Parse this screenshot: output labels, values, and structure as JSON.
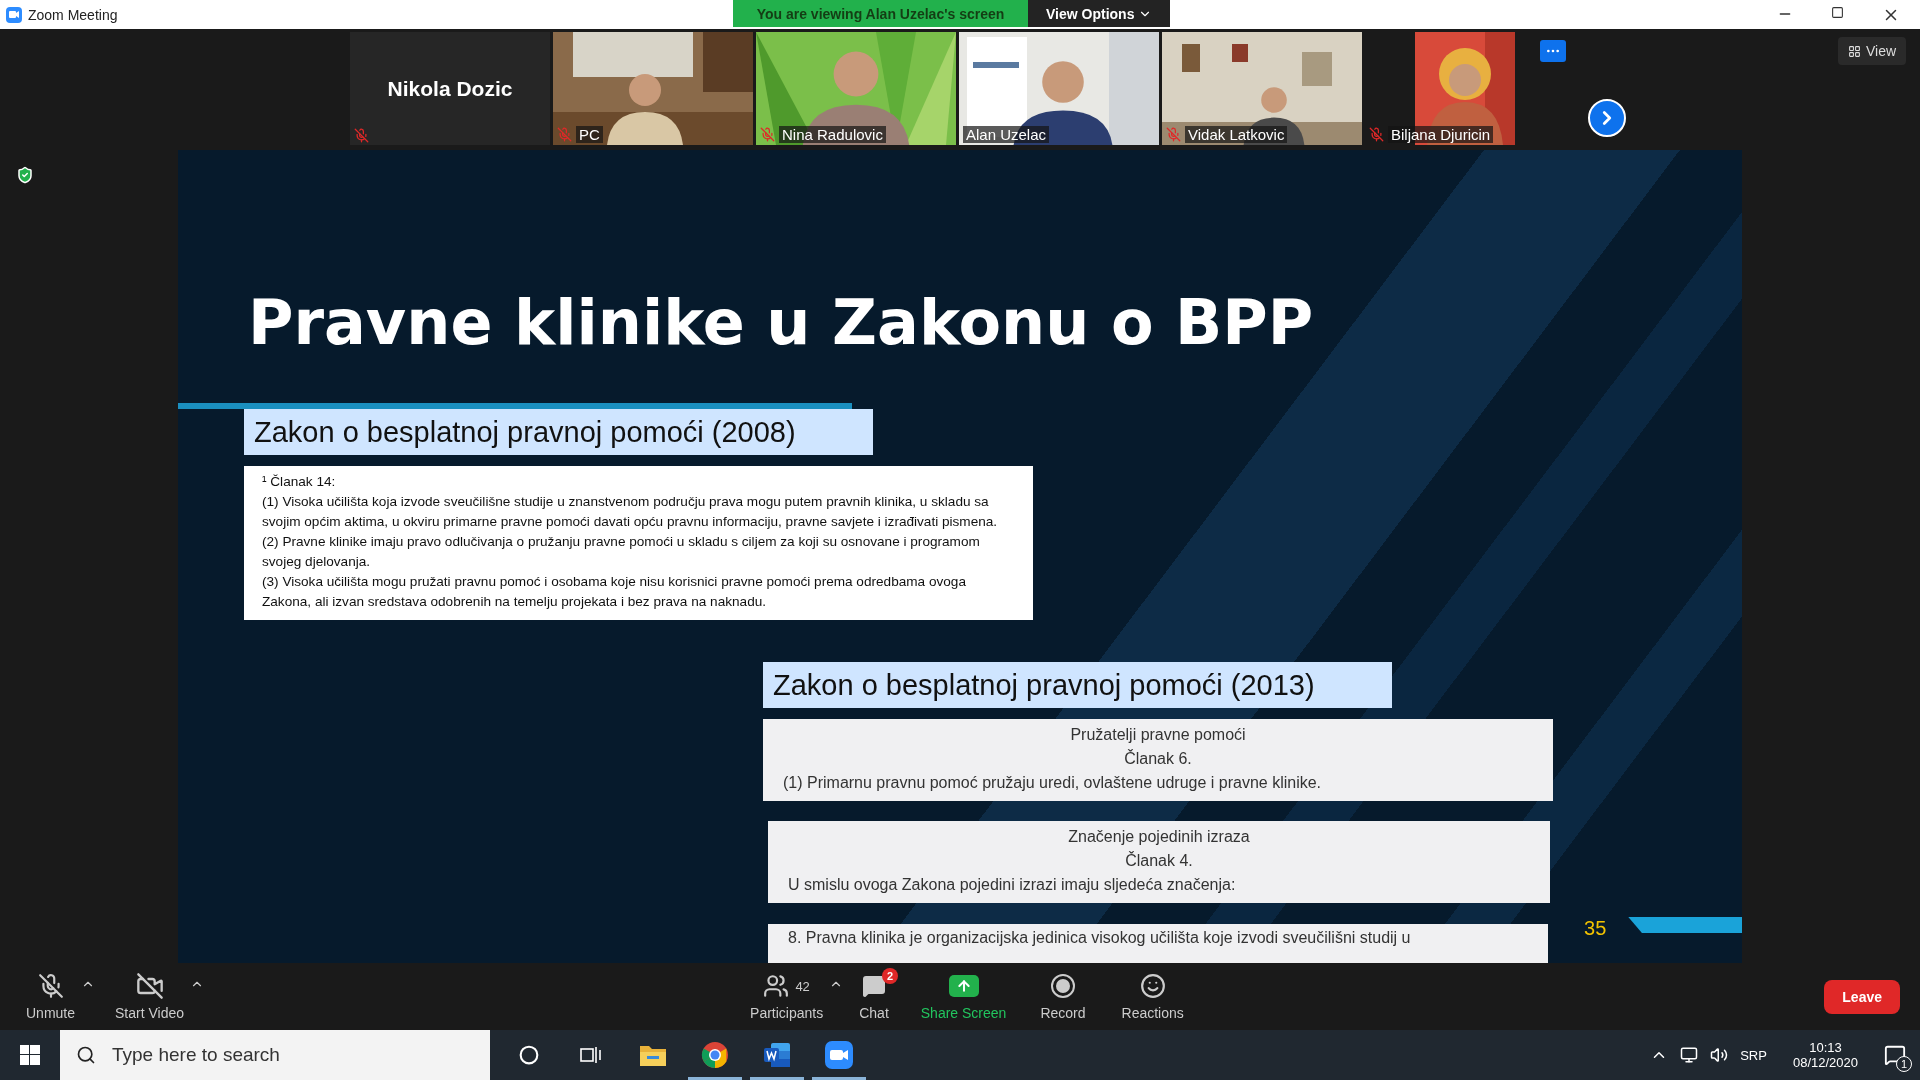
{
  "window": {
    "title": "Zoom Meeting"
  },
  "share_banner": {
    "text": "You are viewing Alan Uzelac's screen",
    "view_options": "View Options"
  },
  "participants_strip": [
    {
      "name": "Nikola Dozic",
      "kind": "name",
      "muted": true
    },
    {
      "name": "PC",
      "kind": "video",
      "muted": true
    },
    {
      "name": "Nina Radulovic",
      "kind": "video",
      "muted": true
    },
    {
      "name": "Alan Uzelac",
      "kind": "video",
      "muted": false
    },
    {
      "name": "Vidak Latkovic",
      "kind": "video",
      "muted": true
    },
    {
      "name": "Biljana Djuricin",
      "kind": "video",
      "muted": true
    }
  ],
  "view_button": "View",
  "slide": {
    "title": "Pravne klinike u Zakonu o BPP",
    "label_2008": "Zakon o besplatnoj pravnoj pomoći (2008)",
    "excerpt_2008": [
      "¹ Članak 14:",
      "(1) Visoka učilišta koja izvode sveučilišne studije u znanstvenom području prava mogu putem pravnih klinika, u skladu sa svojim općim aktima, u okviru primarne pravne pomoći davati opću pravnu informaciju, pravne savjete i izrađivati pismena.",
      "(2) Pravne klinike imaju pravo odlučivanja o pružanju pravne pomoći u skladu s ciljem za koji su osnovane i programom svojeg djelovanja.",
      "(3) Visoka učilišta mogu pružati pravnu pomoć i osobama koje nisu korisnici pravne pomoći prema odredbama ovoga Zakona, ali izvan sredstava odobrenih na temelju projekata i bez prava na naknadu."
    ],
    "label_2013": "Zakon o besplatnoj pravnoj pomoći (2013)",
    "articles_2013": [
      {
        "heading": "Pružatelji pravne pomoći",
        "article": "Članak 6.",
        "text": "(1) Primarnu pravnu pomoć pružaju uredi, ovlaštene udruge i pravne klinike."
      },
      {
        "heading": "Značenje pojedinih izraza",
        "article": "Članak 4.",
        "text": "U smislu ovoga Zakona pojedini izrazi imaju sljedeća značenja:"
      }
    ],
    "cut_line": "8. Pravna klinika je organizacijska jedinica visokog učilišta koje izvodi sveučilišni studij u",
    "page_number": "35"
  },
  "toolbar": [
    {
      "kind": "mic",
      "label": "Unmute"
    },
    {
      "kind": "video",
      "label": "Start Video"
    },
    {
      "kind": "participants",
      "label": "Participants",
      "count": "42"
    },
    {
      "kind": "chat",
      "label": "Chat",
      "badge": "2"
    },
    {
      "kind": "share",
      "label": "Share Screen"
    },
    {
      "kind": "record",
      "label": "Record"
    },
    {
      "kind": "reactions",
      "label": "Reactions"
    }
  ],
  "leave_button": "Leave",
  "taskbar": {
    "search_placeholder": "Type here to search",
    "apps": [
      {
        "kind": "explorer",
        "running": false
      },
      {
        "kind": "chrome",
        "running": true
      },
      {
        "kind": "word",
        "running": true
      },
      {
        "kind": "zoom",
        "running": true
      }
    ],
    "language": "SRP",
    "time": "10:13",
    "date": "08/12/2020",
    "notification_count": "1"
  }
}
